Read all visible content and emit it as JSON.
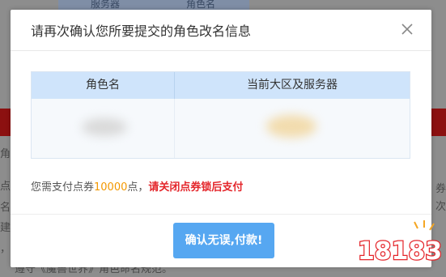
{
  "background": {
    "table_headers": [
      "服务器",
      "角色名"
    ],
    "side_fragments": [
      "角信",
      "点",
      "名",
      "建",
      "，",
      "遵守《魔兽世界》角色命名规范。"
    ],
    "right_fragments": [
      "券",
      "次"
    ]
  },
  "dialog": {
    "title": "请再次确认您所要提交的角色改名信息",
    "table": {
      "headers": [
        "角色名",
        "当前大区及服务器"
      ]
    },
    "notice": {
      "prefix": "您需支付点券",
      "amount": "10000",
      "suffix": "点，",
      "warning": "请关闭点券锁后支付"
    },
    "confirm_label": "确认无误,付款!"
  },
  "watermark": {
    "logo_text": "18183"
  },
  "colors": {
    "header_bg": "#cfe4fb",
    "button": "#56a7f1",
    "amount": "#f39800",
    "warning": "#e4262b"
  }
}
